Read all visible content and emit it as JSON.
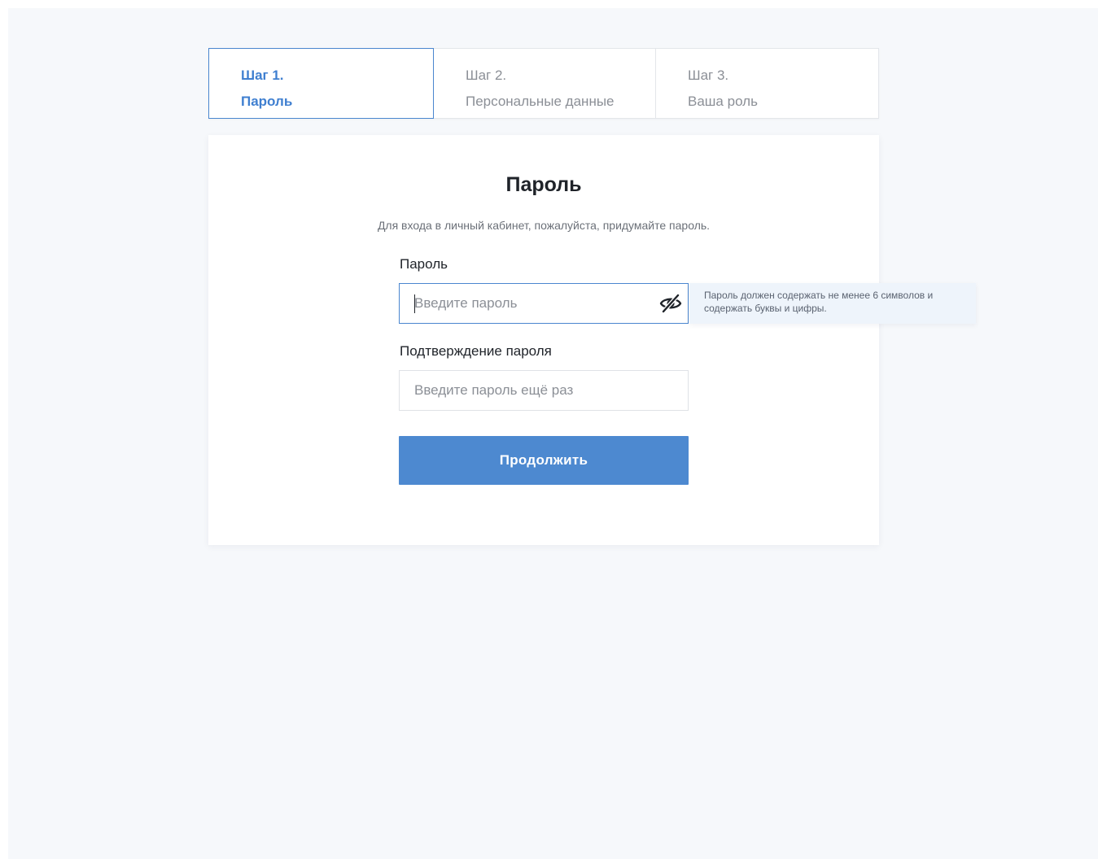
{
  "stepper": {
    "steps": [
      {
        "number": "Шаг 1.",
        "title": "Пароль",
        "active": true
      },
      {
        "number": "Шаг 2.",
        "title": "Персональные данные",
        "active": false
      },
      {
        "number": "Шаг 3.",
        "title": "Ваша роль",
        "active": false
      }
    ]
  },
  "form": {
    "title": "Пароль",
    "subtitle": "Для входа в личный кабинет, пожалуйста, придумайте пароль.",
    "password": {
      "label": "Пароль",
      "value": "",
      "placeholder": "Введите пароль",
      "toggle_icon": "eye-slash-icon",
      "hint": "Пароль должен содержать не менее 6 символов и содержать буквы и цифры."
    },
    "confirm": {
      "label": "Подтверждение пароля",
      "value": "",
      "placeholder": "Введите пароль ещё раз"
    },
    "submit_label": "Продолжить"
  },
  "colors": {
    "accent": "#4d89d0",
    "active_step_text": "#3f7fd0",
    "background": "#f6f8fb",
    "tooltip_bg": "#eef4fb"
  }
}
